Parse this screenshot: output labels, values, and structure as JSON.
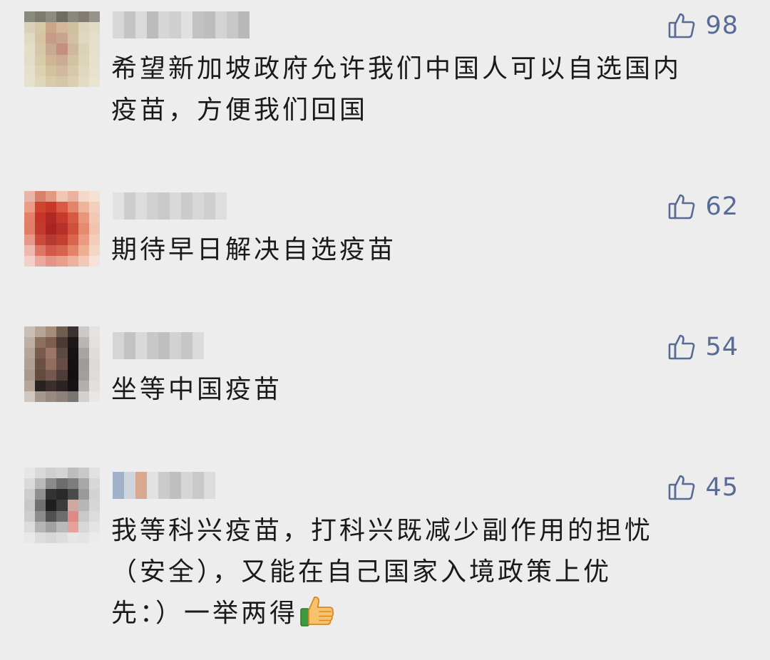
{
  "comments": [
    {
      "like_count": "98",
      "text": "希望新加坡政府允许我们中国人可以自选国内\n疫苗，方便我们回国"
    },
    {
      "like_count": "62",
      "text": "期待早日解决自选疫苗"
    },
    {
      "like_count": "54",
      "text": "坐等中国疫苗"
    },
    {
      "like_count": "45",
      "text": "我等科兴疫苗，打科兴既减少副作用的担忧\n（安全），又能在自己国家入境政策上优\n先：）一举两得",
      "emoji": "thumbs-up-emoji"
    }
  ],
  "icons": {
    "like": "thumbs-up-outline-icon"
  },
  "colors": {
    "background": "#ededed",
    "like_accent": "#576b95",
    "text": "#1a1a1a"
  }
}
